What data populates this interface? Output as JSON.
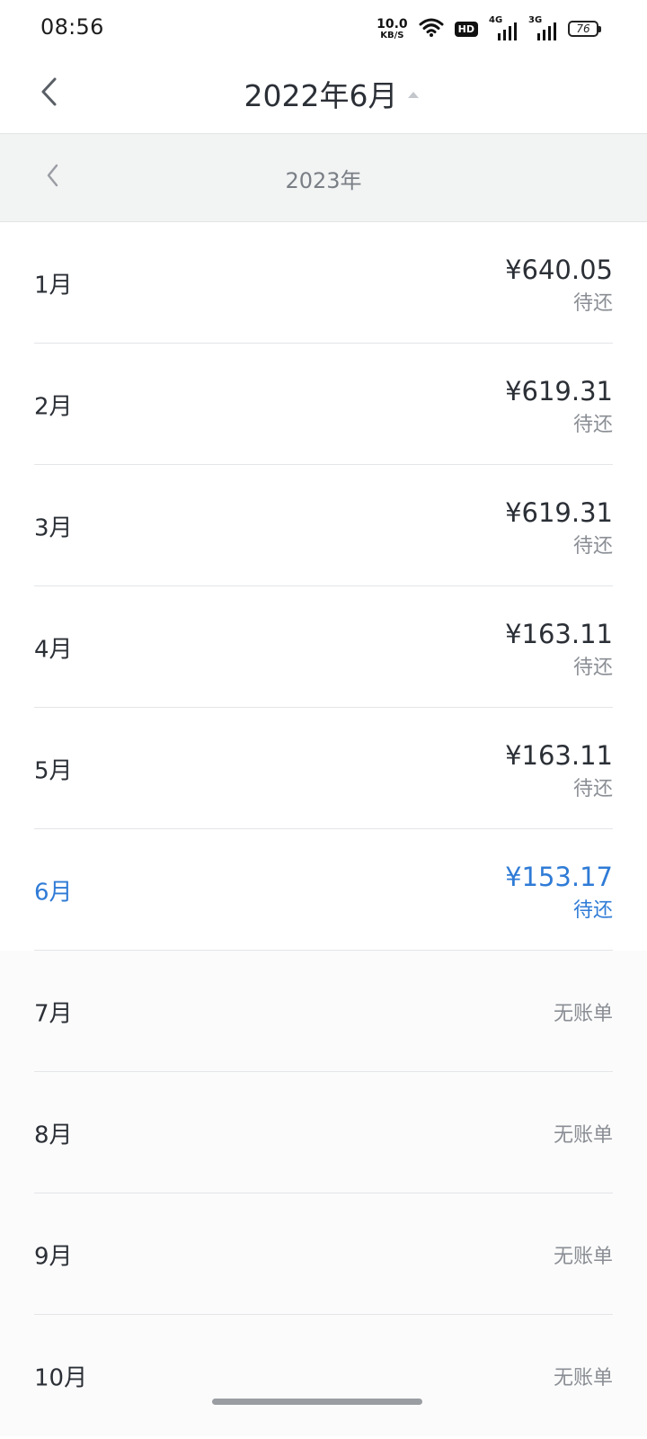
{
  "status_bar": {
    "time": "08:56",
    "net_speed_value": "10.0",
    "net_speed_unit": "KB/S",
    "hd_label": "HD",
    "signal_1_label": "4G",
    "signal_2_label": "3G",
    "battery_level": "76"
  },
  "header": {
    "title": "2022年6月"
  },
  "year_selector": {
    "year": "2023年"
  },
  "months": [
    {
      "label": "1月",
      "amount": "¥640.05",
      "status": "待还"
    },
    {
      "label": "2月",
      "amount": "¥619.31",
      "status": "待还"
    },
    {
      "label": "3月",
      "amount": "¥619.31",
      "status": "待还"
    },
    {
      "label": "4月",
      "amount": "¥163.11",
      "status": "待还"
    },
    {
      "label": "5月",
      "amount": "¥163.11",
      "status": "待还"
    },
    {
      "label": "6月",
      "amount": "¥153.17",
      "status": "待还"
    },
    {
      "label": "7月",
      "no_bill": "无账单"
    },
    {
      "label": "8月",
      "no_bill": "无账单"
    },
    {
      "label": "9月",
      "no_bill": "无账单"
    },
    {
      "label": "10月",
      "no_bill": "无账单"
    }
  ],
  "colors": {
    "accent": "#2f7bd6",
    "text_primary": "#2b2f36",
    "text_secondary": "#8a8e94",
    "year_bar_bg": "#f2f3f3"
  }
}
